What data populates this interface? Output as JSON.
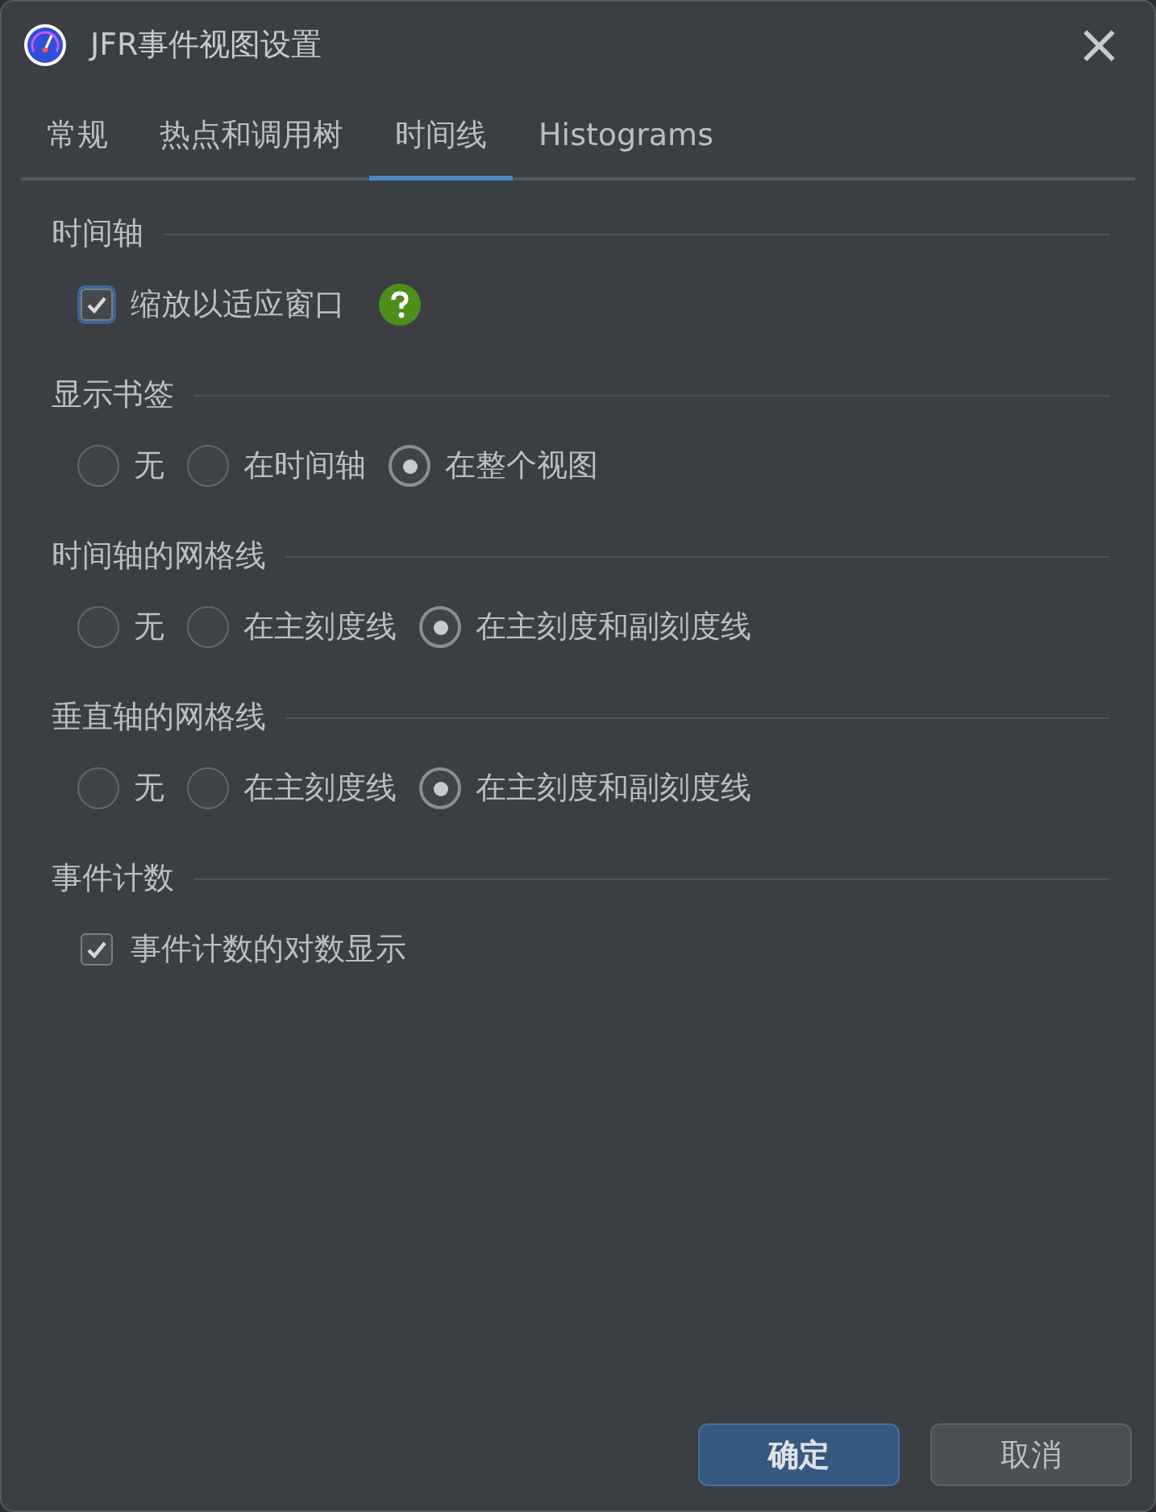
{
  "window": {
    "title": "JFR事件视图设置",
    "close": "×"
  },
  "tabs": [
    {
      "label": "常规",
      "selected": false
    },
    {
      "label": "热点和调用树",
      "selected": false
    },
    {
      "label": "时间线",
      "selected": true
    },
    {
      "label": "Histograms",
      "selected": false
    }
  ],
  "sections": [
    {
      "title": "时间轴",
      "kind": "checkbox",
      "options": [
        {
          "label": "缩放以适应窗口",
          "checked": true,
          "focused": true,
          "help": true
        }
      ]
    },
    {
      "title": "显示书签",
      "kind": "radio",
      "options": [
        {
          "label": "无",
          "selected": false
        },
        {
          "label": "在时间轴",
          "selected": false
        },
        {
          "label": "在整个视图",
          "selected": true
        }
      ]
    },
    {
      "title": "时间轴的网格线",
      "kind": "radio",
      "options": [
        {
          "label": "无",
          "selected": false
        },
        {
          "label": "在主刻度线",
          "selected": false
        },
        {
          "label": "在主刻度和副刻度线",
          "selected": true
        }
      ]
    },
    {
      "title": "垂直轴的网格线",
      "kind": "radio",
      "options": [
        {
          "label": "无",
          "selected": false
        },
        {
          "label": "在主刻度线",
          "selected": false
        },
        {
          "label": "在主刻度和副刻度线",
          "selected": true
        }
      ]
    },
    {
      "title": "事件计数",
      "kind": "checkbox",
      "options": [
        {
          "label": "事件计数的对数显示",
          "checked": true
        }
      ]
    }
  ],
  "buttons": [
    {
      "label": "确定",
      "kind": "primary"
    },
    {
      "label": "取消",
      "kind": "secondary"
    }
  ]
}
